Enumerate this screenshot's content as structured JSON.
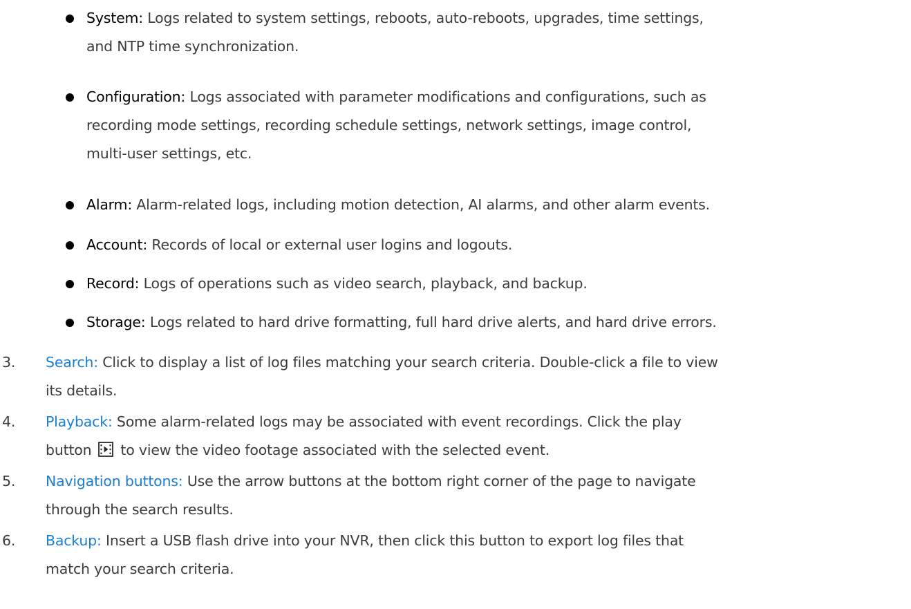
{
  "bullets": [
    {
      "term": "System:",
      "lines": [
        " Logs related to system settings, reboots, auto-reboots, upgrades, time settings,",
        "and NTP time synchronization."
      ]
    },
    {
      "term": "Configuration:",
      "lines": [
        " Logs associated with parameter modifications and configurations, such as",
        "recording mode settings, recording schedule settings, network settings, image control,",
        "multi-user settings, etc."
      ]
    },
    {
      "term": "Alarm:",
      "lines": [
        " Alarm-related logs, including motion detection, AI alarms, and other alarm events."
      ]
    },
    {
      "term": "Account:",
      "lines": [
        " Records of local or external user logins and logouts."
      ]
    },
    {
      "term": "Record:",
      "lines": [
        " Logs of operations such as video search, playback, and backup."
      ]
    },
    {
      "term": "Storage:",
      "lines": [
        " Logs related to hard drive formatting, full hard drive alerts, and hard drive errors."
      ]
    }
  ],
  "numbered": [
    {
      "number": "3.",
      "term": "Search:",
      "lines": [
        " Click to display a list of log files matching your search criteria. Double-click a file to view",
        "its details."
      ]
    },
    {
      "number": "4.",
      "term": "Playback:",
      "lines": [
        " Some alarm-related logs may be associated with event recordings. Click the play",
        "button",
        "to view the video footage associated with the selected event."
      ],
      "icon": "play-button-icon"
    },
    {
      "number": "5.",
      "term": "Navigation buttons:",
      "lines": [
        " Use the arrow buttons at the bottom right corner of the page to navigate",
        "through the search results."
      ]
    },
    {
      "number": "6.",
      "term": "Backup:",
      "lines": [
        " Insert a USB flash drive into your NVR, then click this button to export log files that",
        "match your search criteria."
      ]
    }
  ],
  "colors": {
    "term_black": "#000000",
    "term_blue": "#1a7fd4",
    "body_text": "#3c3c3c"
  }
}
